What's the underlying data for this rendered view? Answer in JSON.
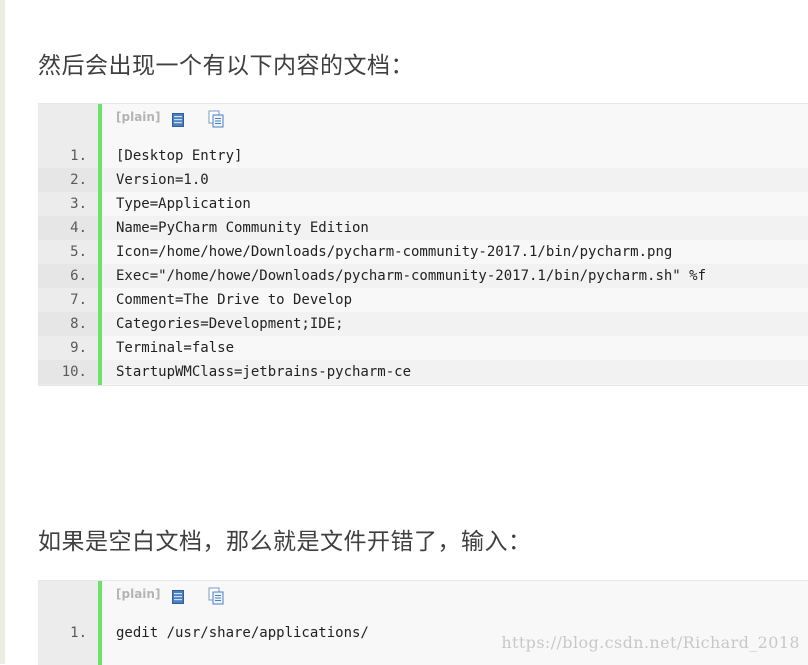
{
  "paragraphs": {
    "first": "然后会出现一个有以下内容的文档：",
    "second": "如果是空白文档，那么就是文件开错了，输入："
  },
  "code_blocks": [
    {
      "toolbar": {
        "label": "[plain]",
        "view_icon": "view-source-icon",
        "copy_icon": "copy-to-clipboard-icon"
      },
      "lines": [
        {
          "number": "1.",
          "text": "[Desktop Entry]"
        },
        {
          "number": "2.",
          "text": "Version=1.0"
        },
        {
          "number": "3.",
          "text": "Type=Application"
        },
        {
          "number": "4.",
          "text": "Name=PyCharm Community Edition"
        },
        {
          "number": "5.",
          "text": "Icon=/home/howe/Downloads/pycharm-community-2017.1/bin/pycharm.png"
        },
        {
          "number": "6.",
          "text": "Exec=\"/home/howe/Downloads/pycharm-community-2017.1/bin/pycharm.sh\" %f"
        },
        {
          "number": "7.",
          "text": "Comment=The Drive to Develop"
        },
        {
          "number": "8.",
          "text": "Categories=Development;IDE;"
        },
        {
          "number": "9.",
          "text": "Terminal=false"
        },
        {
          "number": "10.",
          "text": "StartupWMClass=jetbrains-pycharm-ce"
        }
      ]
    },
    {
      "toolbar": {
        "label": "[plain]",
        "view_icon": "view-source-icon",
        "copy_icon": "copy-to-clipboard-icon"
      },
      "lines": [
        {
          "number": "1.",
          "text": "gedit /usr/share/applications/"
        }
      ]
    }
  ],
  "watermark": "https://blog.csdn.net/Richard_2018",
  "colors": {
    "accent_bar": "#6ce26c",
    "gutter": "#ececec",
    "code_bg": "#f8f8f8",
    "icon_blue": "#4a7fc1"
  }
}
